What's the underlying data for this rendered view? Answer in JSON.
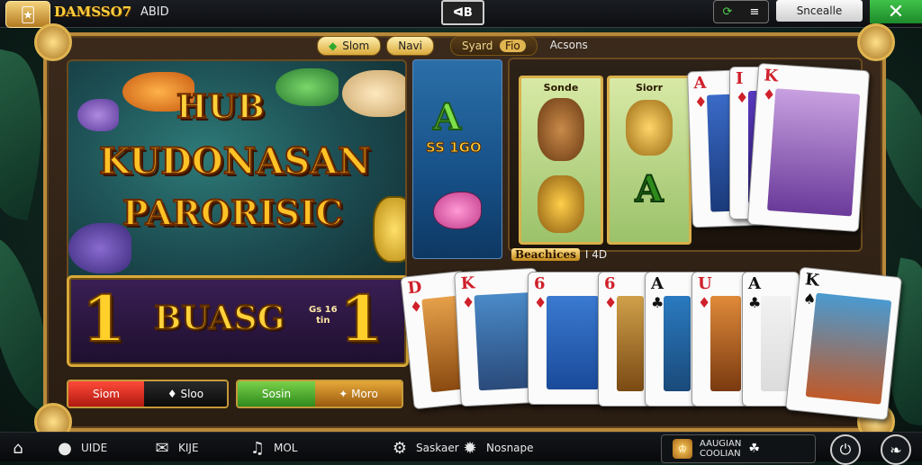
{
  "topbar": {
    "avatar_icon": "jester-avatar-icon",
    "brand": "DAMSSO7",
    "brand_sub": "ABID",
    "mid_button": "ᐊB",
    "toggle_icons": [
      "refresh-icon",
      "equalizer-icon"
    ],
    "search_label": "Sncealle",
    "close_label": "✕"
  },
  "tabs": {
    "tab1": "Slom",
    "tab2": "Navi",
    "tab3": "Syard",
    "tab4": "Fio",
    "tab5": "Acsons"
  },
  "slot": {
    "title_line1": "HUB",
    "title_line2": "KUDONASAN",
    "title_line3": "PARORISIC",
    "jackpot_digit_left": "1",
    "jackpot_text": "BUASG",
    "jackpot_small": "Gs 16\ntin",
    "jackpot_digit_right": "1"
  },
  "buttons": {
    "left_red": "Siom",
    "left_dark": "♦ Sloo",
    "right_green": "Sosin",
    "right_gold": "✦ Moro"
  },
  "middle": {
    "letter": "A",
    "number": "SS 1GO"
  },
  "symbols": {
    "sym1_label": "Sonde",
    "sym2_label": "Siorr",
    "sym2_letter": "A"
  },
  "cards_top": [
    {
      "rank": "A",
      "suit": "♦",
      "color": "#d0202a"
    },
    {
      "rank": "I",
      "suit": "♦",
      "color": "#d0202a"
    },
    {
      "rank": "K",
      "suit": "♦",
      "color": "#d0202a"
    }
  ],
  "bonus": {
    "label": "Beachices",
    "value": "I 4D"
  },
  "cards_bottom": [
    {
      "rank": "D",
      "suit": "♦",
      "color": "#d0202a"
    },
    {
      "rank": "K",
      "suit": "♦",
      "color": "#d0202a"
    },
    {
      "rank": "6",
      "suit": "♦",
      "color": "#d0202a"
    },
    {
      "rank": "6",
      "suit": "♦",
      "color": "#d0202a"
    },
    {
      "rank": "A",
      "suit": "♣",
      "color": "#111111"
    },
    {
      "rank": "U",
      "suit": "♦",
      "color": "#d0202a"
    },
    {
      "rank": "A",
      "suit": "♣",
      "color": "#111111"
    },
    {
      "rank": "K",
      "suit": "♠",
      "color": "#111111"
    }
  ],
  "bottombar": {
    "home_label": "UIDE",
    "mail_label": "KIJE",
    "music_label": "MOL",
    "info_left": "Saskaer",
    "info_mid": "Nosnape",
    "promo_line1": "AAUGIAN",
    "promo_line2": "COOLIAN",
    "promo_right": "☘"
  }
}
